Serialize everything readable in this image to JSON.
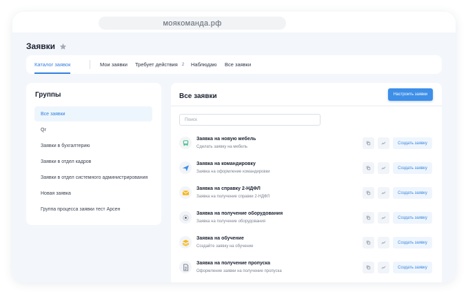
{
  "browser": {
    "url": "моякоманда.рф"
  },
  "page": {
    "title": "Заявки"
  },
  "tabs": [
    {
      "label": "Каталог заявок",
      "active": true
    },
    {
      "label": "Мои заявки"
    },
    {
      "label": "Требует действия",
      "badge": "2"
    },
    {
      "label": "Наблюдаю"
    },
    {
      "label": "Все заявки"
    }
  ],
  "groups": {
    "title": "Группы",
    "items": [
      {
        "label": "Все заявки",
        "active": true
      },
      {
        "label": "Qr"
      },
      {
        "label": "Заявки в бухгалтерию"
      },
      {
        "label": "Заявки в отдел кадров"
      },
      {
        "label": "Заявки в отдел системного администрирования"
      },
      {
        "label": "Новая заявка"
      },
      {
        "label": "Группа процесса заявки тест Арсен"
      }
    ]
  },
  "requests": {
    "title": "Все заявки",
    "configure_label": "Настроить заявки",
    "search_placeholder": "Поиск",
    "create_label": "Создать заявку",
    "items": [
      {
        "title": "Заявка на новую мебель",
        "subtitle": "Сделать заявку на мебель",
        "icon": "chair-icon"
      },
      {
        "title": "Заявка на командировку",
        "subtitle": "Заявка на оформление командировки",
        "icon": "plane-icon"
      },
      {
        "title": "Заявка на справку 2-НДФЛ",
        "subtitle": "Заявка на получение справки 2-НДФЛ",
        "icon": "envelope-icon"
      },
      {
        "title": "Заявка на получение оборудования",
        "subtitle": "Заявка на получение оборудования",
        "icon": "equipment-icon"
      },
      {
        "title": "Заявка на обучение",
        "subtitle": "Создайте заявку на обучение",
        "icon": "layers-icon"
      },
      {
        "title": "Заявка на получение пропуска",
        "subtitle": "Оформление заявки на получение пропуска",
        "icon": "document-icon"
      }
    ]
  },
  "colors": {
    "accent": "#2f7fe0",
    "button": "#3d8fe8",
    "background": "#f3f6fa"
  }
}
